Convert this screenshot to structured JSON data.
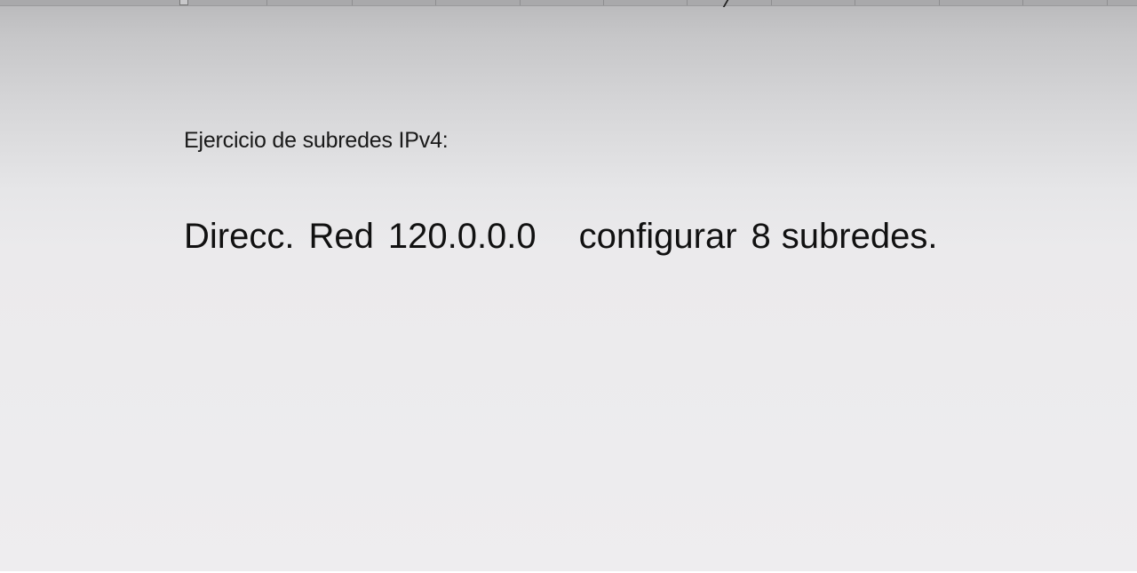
{
  "document": {
    "heading": "Ejercicio de subredes IPv4:",
    "line": {
      "part1": "Direcc.",
      "part2": "Red",
      "part3": "120.0.0.0",
      "part4": "configurar",
      "part5": "8",
      "part6": "subredes."
    }
  },
  "colors": {
    "text": "#111111",
    "page": "#ebeaec",
    "ruler": "#a9a9ab"
  },
  "icons": {
    "ruler_indent": "indent-marker-icon"
  }
}
